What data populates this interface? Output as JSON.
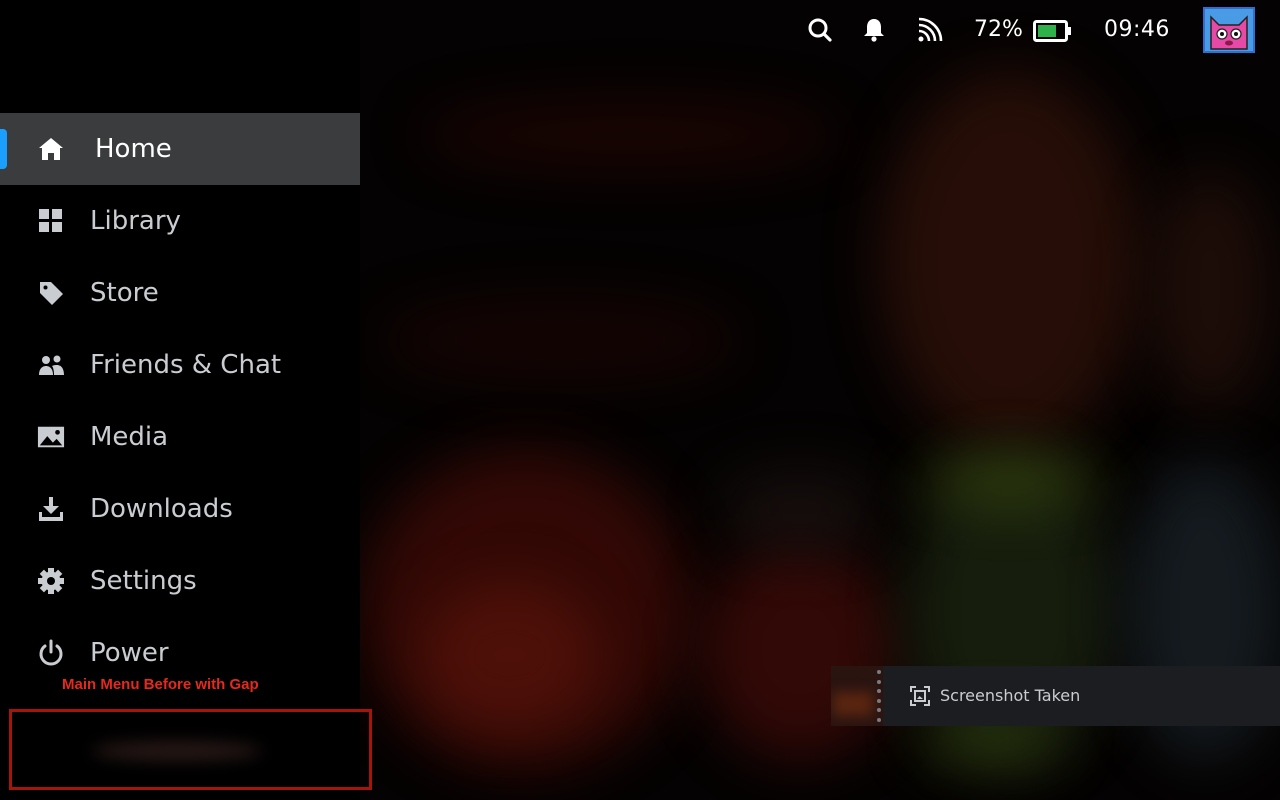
{
  "status_bar": {
    "icons": [
      "search-icon",
      "notification-bell-icon",
      "wifi-icon",
      "battery-icon"
    ],
    "battery_percent": "72%",
    "battery_level": 0.72,
    "time": "09:46",
    "avatar": "pink-cat-avatar"
  },
  "menu": {
    "items": [
      {
        "label": "Home",
        "icon": "home-icon",
        "active": true
      },
      {
        "label": "Library",
        "icon": "grid-icon",
        "active": false
      },
      {
        "label": "Store",
        "icon": "tag-icon",
        "active": false
      },
      {
        "label": "Friends & Chat",
        "icon": "people-icon",
        "active": false
      },
      {
        "label": "Media",
        "icon": "image-icon",
        "active": false
      },
      {
        "label": "Downloads",
        "icon": "download-icon",
        "active": false
      },
      {
        "label": "Settings",
        "icon": "gear-icon",
        "active": false
      },
      {
        "label": "Power",
        "icon": "power-icon",
        "active": false
      }
    ],
    "accent_color": "#1a9fff",
    "active_bg": "#3b3c3e"
  },
  "annotation": {
    "text": "Main Menu Before with Gap",
    "color": "#e6291e"
  },
  "toast": {
    "label": "Screenshot Taken",
    "icon": "screenshot-icon"
  }
}
